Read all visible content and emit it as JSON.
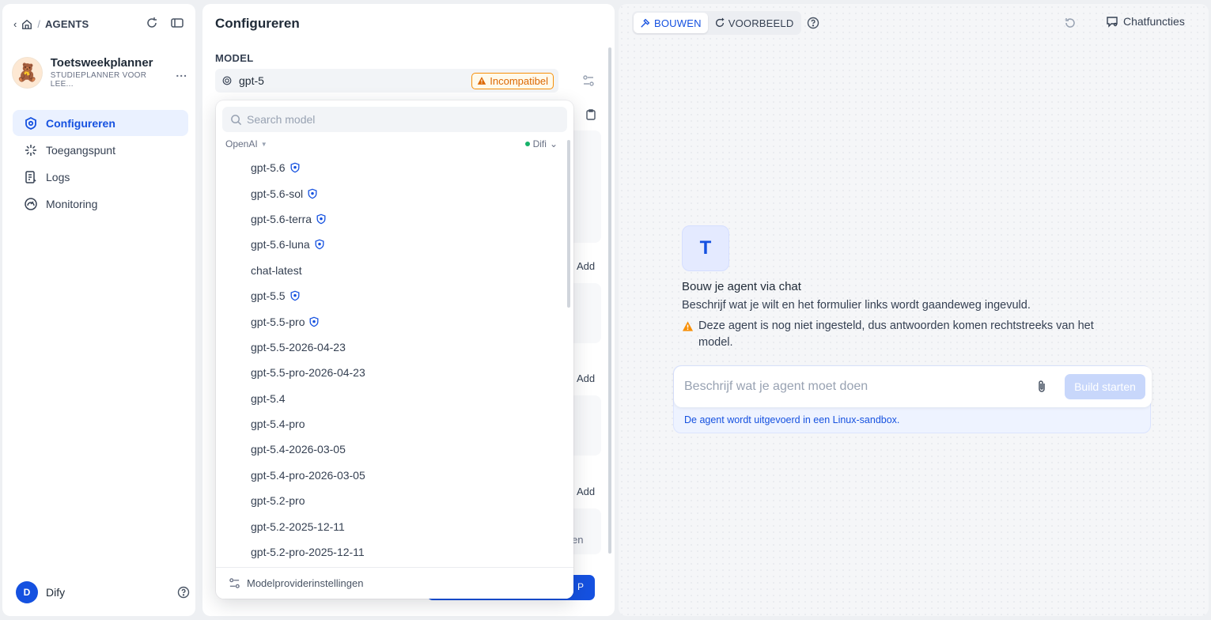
{
  "sidebar": {
    "section": "AGENTS",
    "agent_name": "Toetsweekplanner",
    "agent_subtitle": "STUDIEPLANNER VOOR LEE...",
    "avatar_emoji": "🧸",
    "more": "...",
    "nav": [
      {
        "label": "Configureren",
        "icon": "gear-icon",
        "active": true
      },
      {
        "label": "Toegangspunt",
        "icon": "sparkle-icon"
      },
      {
        "label": "Logs",
        "icon": "log-icon"
      },
      {
        "label": "Monitoring",
        "icon": "gauge-icon"
      }
    ],
    "user_initial": "D",
    "user_name": "Dify"
  },
  "config": {
    "title": "Configureren",
    "model_label": "MODEL",
    "model_value": "gpt-5",
    "incompatible": "Incompatibel",
    "add_labels": [
      "Add",
      "Add",
      "Add"
    ],
    "fragment": "en",
    "button_fragment": "P"
  },
  "dropdown": {
    "search_placeholder": "Search model",
    "provider": "OpenAI",
    "workspace": "Difi",
    "models": [
      {
        "name": "gpt-5.6",
        "badge": true
      },
      {
        "name": "gpt-5.6-sol",
        "badge": true
      },
      {
        "name": "gpt-5.6-terra",
        "badge": true
      },
      {
        "name": "gpt-5.6-luna",
        "badge": true
      },
      {
        "name": "chat-latest",
        "badge": false
      },
      {
        "name": "gpt-5.5",
        "badge": true
      },
      {
        "name": "gpt-5.5-pro",
        "badge": true
      },
      {
        "name": "gpt-5.5-2026-04-23",
        "badge": false
      },
      {
        "name": "gpt-5.5-pro-2026-04-23",
        "badge": false
      },
      {
        "name": "gpt-5.4",
        "badge": false
      },
      {
        "name": "gpt-5.4-pro",
        "badge": false
      },
      {
        "name": "gpt-5.4-2026-03-05",
        "badge": false
      },
      {
        "name": "gpt-5.4-pro-2026-03-05",
        "badge": false
      },
      {
        "name": "gpt-5.2-pro",
        "badge": false
      },
      {
        "name": "gpt-5.2-2025-12-11",
        "badge": false
      },
      {
        "name": "gpt-5.2-pro-2025-12-11",
        "badge": false
      }
    ],
    "footer": "Modelproviderinstellingen"
  },
  "right": {
    "mode_build": "BOUWEN",
    "mode_preview": "VOORBEELD",
    "chat_features": "Chatfuncties",
    "brand_glyph": "T",
    "intro_heading": "Bouw je agent via chat",
    "intro_text": "Beschrijf wat je wilt en het formulier links wordt gaandeweg ingevuld.",
    "warning": "Deze agent is nog niet ingesteld, dus antwoorden komen rechtstreeks van het model.",
    "prompt_placeholder": "Beschrijf wat je agent moet doen",
    "build_button": "Build starten",
    "sandbox_note": "De agent wordt uitgevoerd in een Linux-sandbox."
  },
  "colors": {
    "accent": "#1551e0",
    "warning": "#f79009",
    "success": "#17b26a"
  }
}
